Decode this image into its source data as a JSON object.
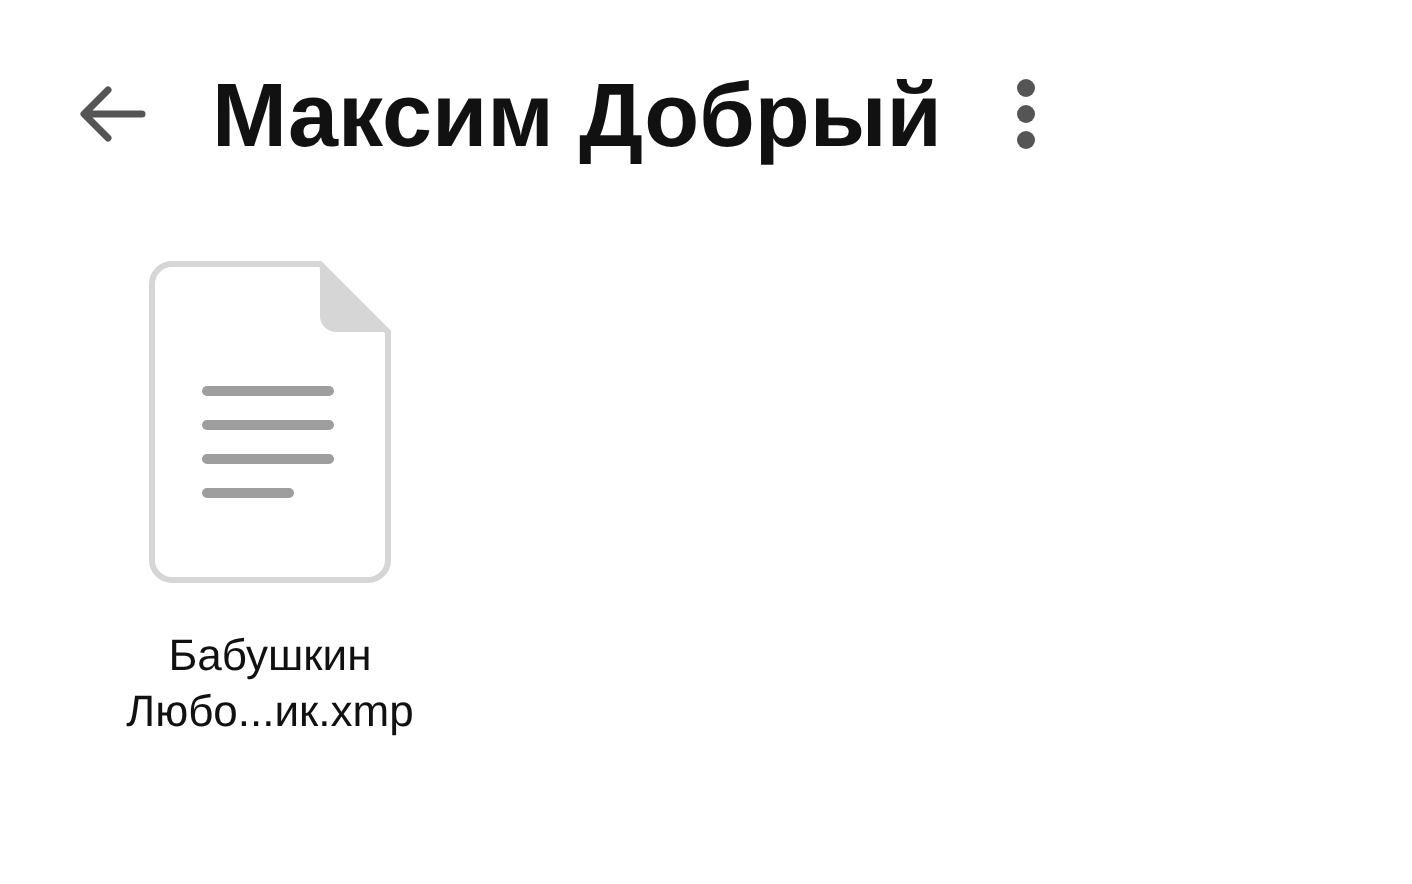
{
  "header": {
    "title": "Максим Добрый"
  },
  "files": [
    {
      "kind": "document",
      "name": "Бабушкин Любо...ик.xmp"
    }
  ]
}
